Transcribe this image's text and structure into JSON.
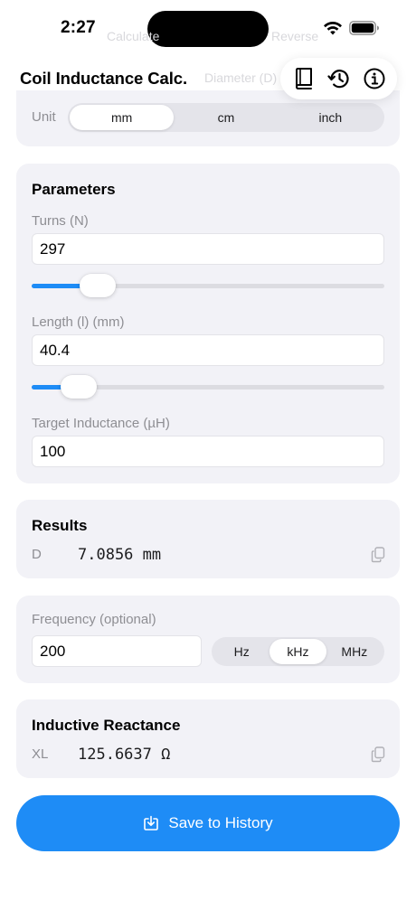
{
  "status_bar": {
    "time": "2:27"
  },
  "ghost": {
    "left": "Calculate",
    "center": "Diameter (D)",
    "right": "Reverse"
  },
  "header": {
    "title": "Coil Inductance Calc.",
    "actions": [
      "book-icon",
      "history-icon",
      "info-icon"
    ]
  },
  "unit": {
    "label": "Unit",
    "options": [
      "mm",
      "cm",
      "inch"
    ],
    "selected": "mm"
  },
  "parameters": {
    "title": "Parameters",
    "turns": {
      "label": "Turns (N)",
      "value": "297",
      "slider_fraction": 0.15
    },
    "length": {
      "label": "Length (l) (mm)",
      "value": "40.4",
      "slider_fraction": 0.09
    },
    "target": {
      "label": "Target Inductance (µH)",
      "value": "100"
    }
  },
  "results": {
    "title": "Results",
    "key": "D",
    "value": "7.0856 mm"
  },
  "frequency": {
    "label": "Frequency (optional)",
    "value": "200",
    "units": [
      "Hz",
      "kHz",
      "MHz"
    ],
    "selected": "kHz"
  },
  "reactance": {
    "title": "Inductive Reactance",
    "key": "XL",
    "value": "125.6637 Ω"
  },
  "save": {
    "label": "Save to History"
  },
  "colors": {
    "accent": "#1e8cf6",
    "card": "#f2f2f7",
    "secondary_text": "#8e8e93"
  }
}
